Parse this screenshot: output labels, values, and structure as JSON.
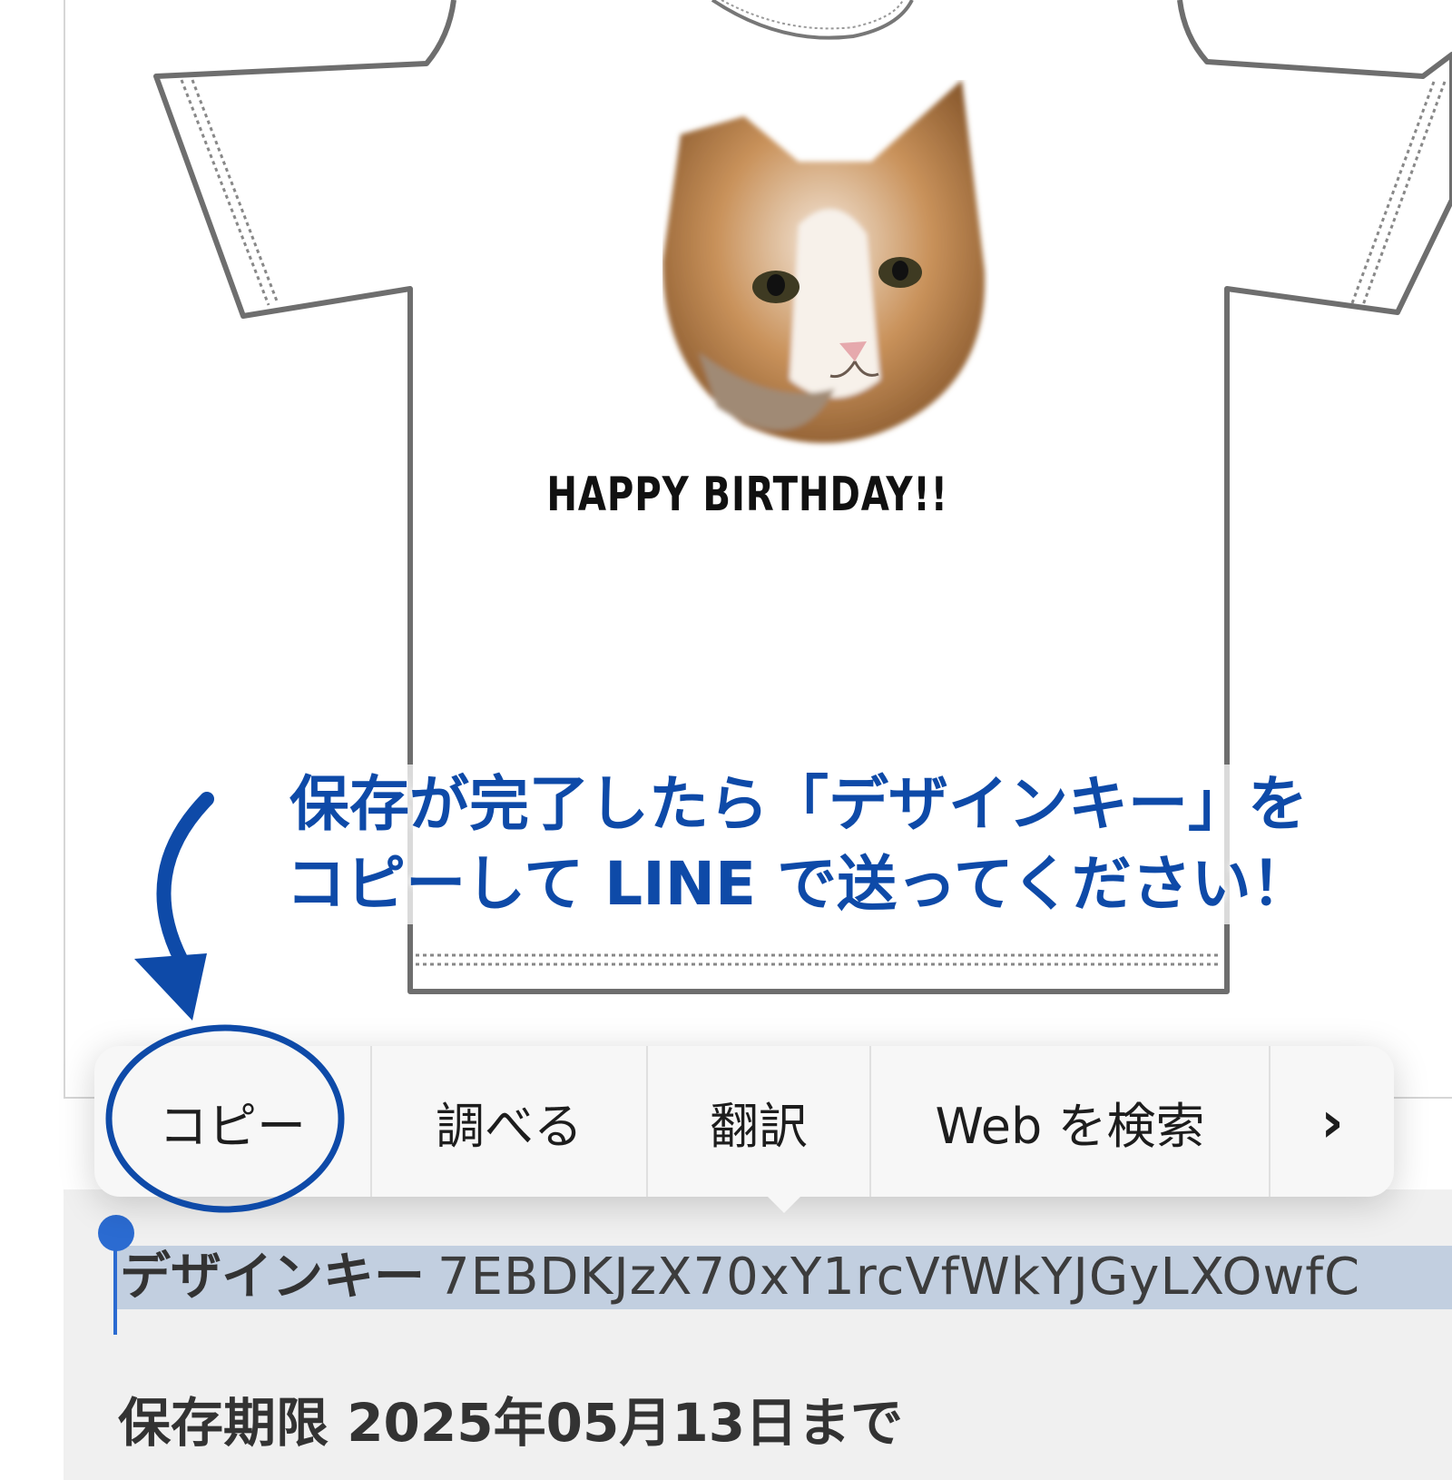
{
  "preview": {
    "print_caption": "HAPPY BIRTHDAY!!",
    "print_image": "cat-face-photo"
  },
  "instruction": {
    "line1": "保存が完了したら「デザインキー」を",
    "line2": "コピーして LINE で送ってください！",
    "color": "#0e4aa8"
  },
  "context_menu": {
    "items": [
      {
        "label": "コピー"
      },
      {
        "label": "調べる"
      },
      {
        "label": "翻訳"
      },
      {
        "label": "Web を検索"
      },
      {
        "label": "›"
      }
    ]
  },
  "design_key": {
    "label": "デザインキー",
    "value": "7EBDKJzX70xY1rcVfWkYJGyLXOwfC"
  },
  "expiry": {
    "text": "保存期限 2025年05月13日まで"
  },
  "colors": {
    "annotation_blue": "#0e4aa8",
    "selection": "#c2cfe0",
    "caret": "#2b6bd1"
  }
}
